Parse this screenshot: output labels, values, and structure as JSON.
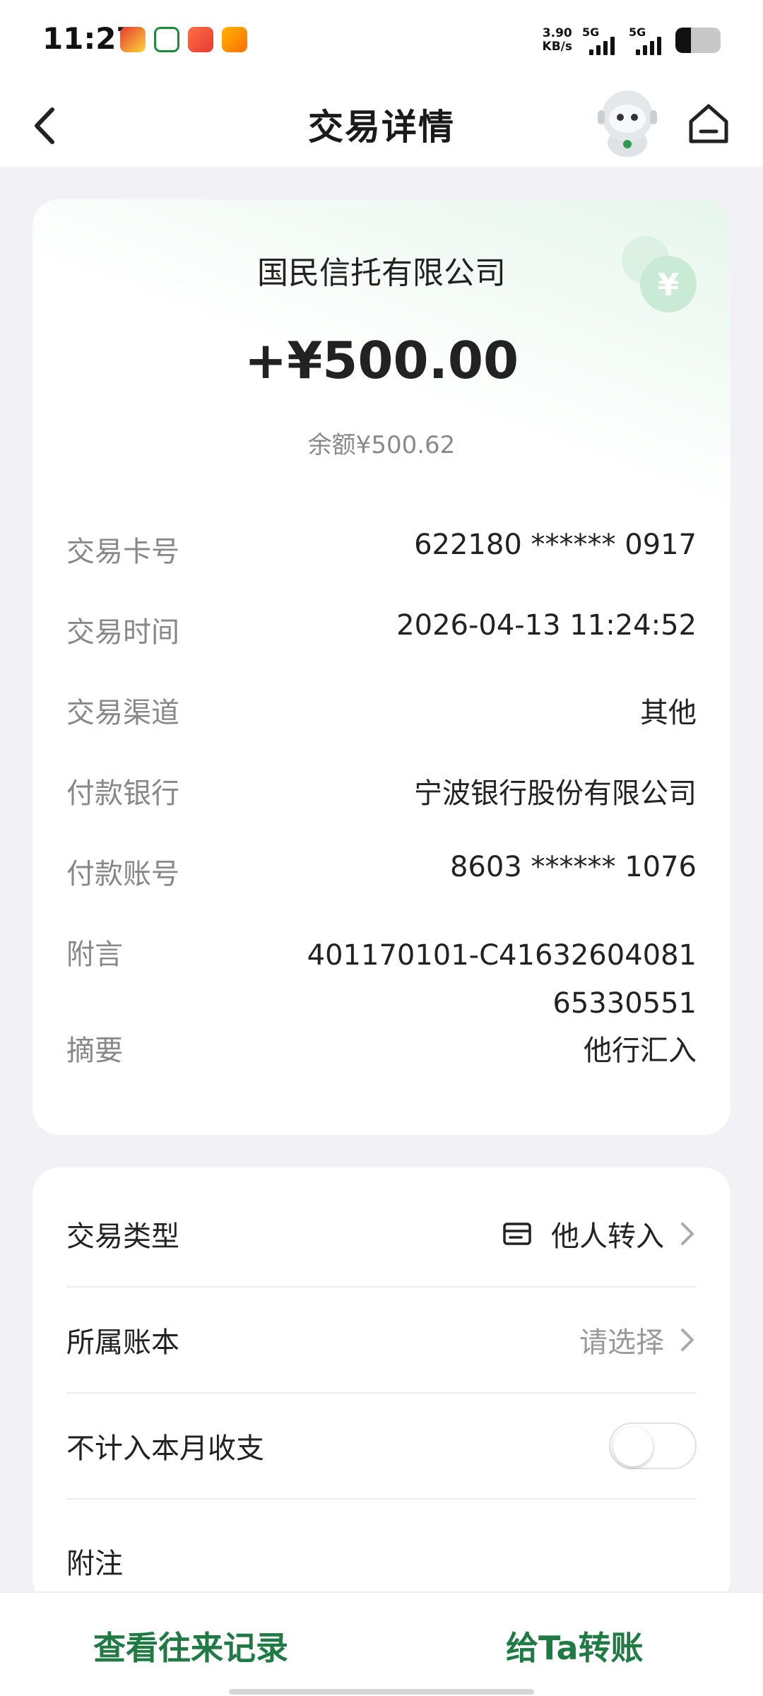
{
  "status_bar": {
    "time": "11:27",
    "net_speed_value": "3.90",
    "net_speed_unit": "KB/s",
    "signal1_label": "5G",
    "signal2_label": "5G",
    "battery_level": 0.35
  },
  "header": {
    "title": "交易详情"
  },
  "transaction": {
    "payee": "国民信托有限公司",
    "amount": "+¥500.00",
    "balance": "余额¥500.62",
    "rows": [
      {
        "label": "交易卡号",
        "value": "622180 ****** 0917"
      },
      {
        "label": "交易时间",
        "value": "2026-04-13 11:24:52"
      },
      {
        "label": "交易渠道",
        "value": "其他"
      },
      {
        "label": "付款银行",
        "value": "宁波银行股份有限公司"
      },
      {
        "label": "付款账号",
        "value": "8603 ****** 1076"
      },
      {
        "label": "附言",
        "value": "401170101-C4163260408165330551"
      },
      {
        "label": "摘要",
        "value": "他行汇入"
      }
    ]
  },
  "settings": {
    "type_label": "交易类型",
    "type_value": "他人转入",
    "ledger_label": "所属账本",
    "ledger_value": "请选择",
    "exclude_label": "不计入本月收支",
    "exclude_enabled": false,
    "note_label": "附注"
  },
  "bottom": {
    "records_label": "查看往来记录",
    "transfer_label": "给Ta转账"
  },
  "colors": {
    "accent": "#1f7a43",
    "background": "#f2f2f6"
  }
}
